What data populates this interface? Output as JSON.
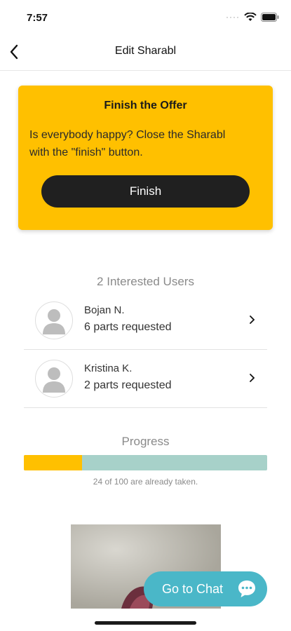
{
  "status_bar": {
    "time": "7:57"
  },
  "nav": {
    "title": "Edit Sharabl"
  },
  "finish_card": {
    "title": "Finish the Offer",
    "text": "Is everybody happy? Close the Sharabl with the \"finish\" button.",
    "button_label": "Finish"
  },
  "interested": {
    "title": "2 Interested Users",
    "users": [
      {
        "name": "Bojan N.",
        "parts": "6 parts requested"
      },
      {
        "name": "Kristina K.",
        "parts": "2 parts requested"
      }
    ]
  },
  "progress": {
    "title": "Progress",
    "taken": 24,
    "total": 100,
    "caption": "24 of 100 are already taken.",
    "fill_color": "#ffc000",
    "track_color": "#a7d1c9"
  },
  "chat": {
    "label": "Go to Chat"
  },
  "colors": {
    "accent": "#ffc000",
    "chat": "#4ab7c8",
    "dark": "#202020"
  }
}
